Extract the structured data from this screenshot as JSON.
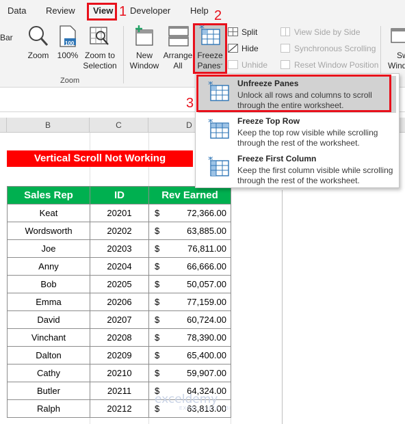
{
  "menu": {
    "tabs": [
      "Data",
      "Review",
      "View",
      "Developer",
      "Help"
    ],
    "active": "View"
  },
  "callouts": [
    "1",
    "2",
    "3"
  ],
  "ribbon": {
    "bar_fragment": "Bar",
    "zoom_group": {
      "label": "Zoom",
      "zoom": "Zoom",
      "zoom100": "100%",
      "zoom100_icon_text": "100",
      "zoom_selection_1": "Zoom to",
      "zoom_selection_2": "Selection"
    },
    "window_group": {
      "new_window_1": "New",
      "new_window_2": "Window",
      "arrange_1": "Arrange",
      "arrange_2": "All",
      "freeze_1": "Freeze",
      "freeze_2": "Panes",
      "split": "Split",
      "hide": "Hide",
      "unhide": "Unhide",
      "view_side_by_side": "View Side by Side",
      "sync_scrolling": "Synchronous Scrolling",
      "reset_position": "Reset Window Position",
      "switch_1": "Sw",
      "switch_2": "Wind"
    }
  },
  "freeze_menu": [
    {
      "title": "Unfreeze Panes",
      "desc": "Unlock all rows and columns to scroll through the entire worksheet."
    },
    {
      "title": "Freeze Top Row",
      "desc": "Keep the top row visible while scrolling through the rest of the worksheet."
    },
    {
      "title": "Freeze First Column",
      "desc": "Keep the first column visible while scrolling through the rest of the worksheet."
    }
  ],
  "columns": [
    "B",
    "C",
    "D"
  ],
  "sheet": {
    "title": "Vertical Scroll Not Working",
    "headers": [
      "Sales Rep",
      "ID",
      "Rev Earned"
    ],
    "currency": "$",
    "rows": [
      [
        "Keat",
        "20201",
        "72,366.00"
      ],
      [
        "Wordsworth",
        "20202",
        "63,885.00"
      ],
      [
        "Joe",
        "20203",
        "76,811.00"
      ],
      [
        "Anny",
        "20204",
        "66,666.00"
      ],
      [
        "Bob",
        "20205",
        "50,057.00"
      ],
      [
        "Emma",
        "20206",
        "77,159.00"
      ],
      [
        "David",
        "20207",
        "60,724.00"
      ],
      [
        "Vinchant",
        "20208",
        "78,390.00"
      ],
      [
        "Dalton",
        "20209",
        "65,400.00"
      ],
      [
        "Cathy",
        "20210",
        "59,907.00"
      ],
      [
        "Butler",
        "20211",
        "64,324.00"
      ],
      [
        "Ralph",
        "20212",
        "63,813.00"
      ]
    ]
  },
  "watermark": {
    "brand": "exceldemy",
    "tagline": "EXCEL · DATA · BI"
  },
  "colors": {
    "accent_red": "#e8101b",
    "header_green": "#00b050",
    "title_red": "#ff0000",
    "icon_blue": "#2e75b6"
  }
}
